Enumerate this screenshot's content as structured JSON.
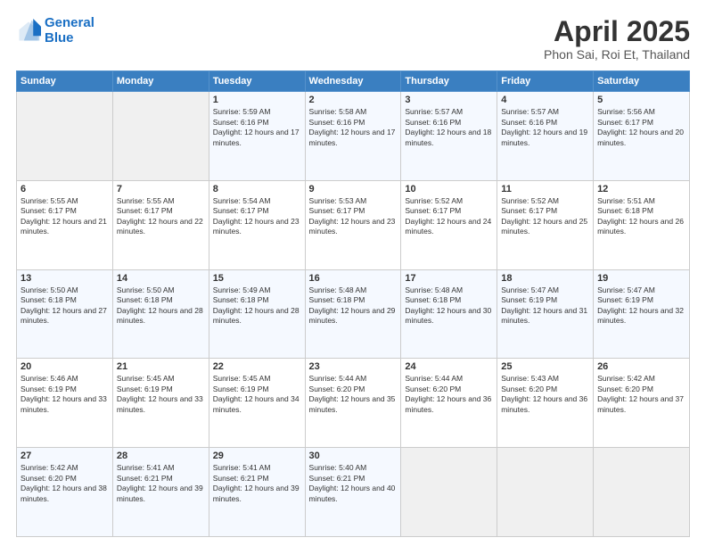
{
  "header": {
    "logo_line1": "General",
    "logo_line2": "Blue",
    "title": "April 2025",
    "subtitle": "Phon Sai, Roi Et, Thailand"
  },
  "days_of_week": [
    "Sunday",
    "Monday",
    "Tuesday",
    "Wednesday",
    "Thursday",
    "Friday",
    "Saturday"
  ],
  "weeks": [
    [
      {
        "day": "",
        "info": ""
      },
      {
        "day": "",
        "info": ""
      },
      {
        "day": "1",
        "info": "Sunrise: 5:59 AM\nSunset: 6:16 PM\nDaylight: 12 hours and 17 minutes."
      },
      {
        "day": "2",
        "info": "Sunrise: 5:58 AM\nSunset: 6:16 PM\nDaylight: 12 hours and 17 minutes."
      },
      {
        "day": "3",
        "info": "Sunrise: 5:57 AM\nSunset: 6:16 PM\nDaylight: 12 hours and 18 minutes."
      },
      {
        "day": "4",
        "info": "Sunrise: 5:57 AM\nSunset: 6:16 PM\nDaylight: 12 hours and 19 minutes."
      },
      {
        "day": "5",
        "info": "Sunrise: 5:56 AM\nSunset: 6:17 PM\nDaylight: 12 hours and 20 minutes."
      }
    ],
    [
      {
        "day": "6",
        "info": "Sunrise: 5:55 AM\nSunset: 6:17 PM\nDaylight: 12 hours and 21 minutes."
      },
      {
        "day": "7",
        "info": "Sunrise: 5:55 AM\nSunset: 6:17 PM\nDaylight: 12 hours and 22 minutes."
      },
      {
        "day": "8",
        "info": "Sunrise: 5:54 AM\nSunset: 6:17 PM\nDaylight: 12 hours and 23 minutes."
      },
      {
        "day": "9",
        "info": "Sunrise: 5:53 AM\nSunset: 6:17 PM\nDaylight: 12 hours and 23 minutes."
      },
      {
        "day": "10",
        "info": "Sunrise: 5:52 AM\nSunset: 6:17 PM\nDaylight: 12 hours and 24 minutes."
      },
      {
        "day": "11",
        "info": "Sunrise: 5:52 AM\nSunset: 6:17 PM\nDaylight: 12 hours and 25 minutes."
      },
      {
        "day": "12",
        "info": "Sunrise: 5:51 AM\nSunset: 6:18 PM\nDaylight: 12 hours and 26 minutes."
      }
    ],
    [
      {
        "day": "13",
        "info": "Sunrise: 5:50 AM\nSunset: 6:18 PM\nDaylight: 12 hours and 27 minutes."
      },
      {
        "day": "14",
        "info": "Sunrise: 5:50 AM\nSunset: 6:18 PM\nDaylight: 12 hours and 28 minutes."
      },
      {
        "day": "15",
        "info": "Sunrise: 5:49 AM\nSunset: 6:18 PM\nDaylight: 12 hours and 28 minutes."
      },
      {
        "day": "16",
        "info": "Sunrise: 5:48 AM\nSunset: 6:18 PM\nDaylight: 12 hours and 29 minutes."
      },
      {
        "day": "17",
        "info": "Sunrise: 5:48 AM\nSunset: 6:18 PM\nDaylight: 12 hours and 30 minutes."
      },
      {
        "day": "18",
        "info": "Sunrise: 5:47 AM\nSunset: 6:19 PM\nDaylight: 12 hours and 31 minutes."
      },
      {
        "day": "19",
        "info": "Sunrise: 5:47 AM\nSunset: 6:19 PM\nDaylight: 12 hours and 32 minutes."
      }
    ],
    [
      {
        "day": "20",
        "info": "Sunrise: 5:46 AM\nSunset: 6:19 PM\nDaylight: 12 hours and 33 minutes."
      },
      {
        "day": "21",
        "info": "Sunrise: 5:45 AM\nSunset: 6:19 PM\nDaylight: 12 hours and 33 minutes."
      },
      {
        "day": "22",
        "info": "Sunrise: 5:45 AM\nSunset: 6:19 PM\nDaylight: 12 hours and 34 minutes."
      },
      {
        "day": "23",
        "info": "Sunrise: 5:44 AM\nSunset: 6:20 PM\nDaylight: 12 hours and 35 minutes."
      },
      {
        "day": "24",
        "info": "Sunrise: 5:44 AM\nSunset: 6:20 PM\nDaylight: 12 hours and 36 minutes."
      },
      {
        "day": "25",
        "info": "Sunrise: 5:43 AM\nSunset: 6:20 PM\nDaylight: 12 hours and 36 minutes."
      },
      {
        "day": "26",
        "info": "Sunrise: 5:42 AM\nSunset: 6:20 PM\nDaylight: 12 hours and 37 minutes."
      }
    ],
    [
      {
        "day": "27",
        "info": "Sunrise: 5:42 AM\nSunset: 6:20 PM\nDaylight: 12 hours and 38 minutes."
      },
      {
        "day": "28",
        "info": "Sunrise: 5:41 AM\nSunset: 6:21 PM\nDaylight: 12 hours and 39 minutes."
      },
      {
        "day": "29",
        "info": "Sunrise: 5:41 AM\nSunset: 6:21 PM\nDaylight: 12 hours and 39 minutes."
      },
      {
        "day": "30",
        "info": "Sunrise: 5:40 AM\nSunset: 6:21 PM\nDaylight: 12 hours and 40 minutes."
      },
      {
        "day": "",
        "info": ""
      },
      {
        "day": "",
        "info": ""
      },
      {
        "day": "",
        "info": ""
      }
    ]
  ]
}
